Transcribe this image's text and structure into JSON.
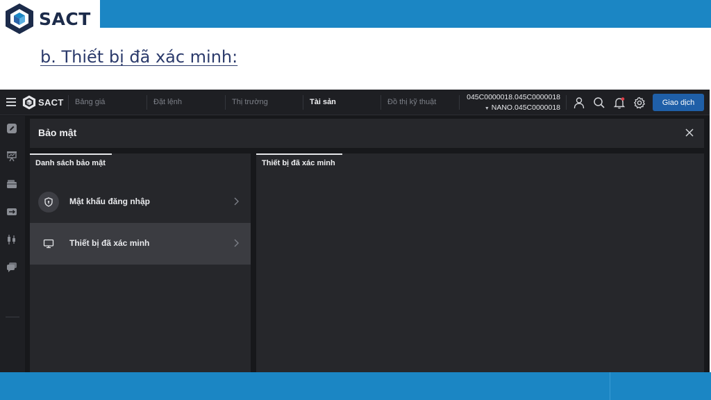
{
  "slide": {
    "logo_text": "SACT",
    "heading": "b. Thiết bị đã xác minh:"
  },
  "app": {
    "logo_text": "SACT",
    "nav": [
      {
        "label": "Bảng giá"
      },
      {
        "label": "Đặt lệnh"
      },
      {
        "label": "Thị trường"
      },
      {
        "label": "Tài sản",
        "active": true
      },
      {
        "label": "Đồ thị kỹ thuật"
      }
    ],
    "account": {
      "line1": "045C0000018.045C0000018",
      "line2": "NANO.045C0000018"
    },
    "trade_button": "Giao dịch",
    "panel": {
      "title": "Bảo mật",
      "left_tab": "Danh sách bảo mật",
      "right_tab": "Thiết bị đã xác minh",
      "items": [
        {
          "label": "Mật khẩu đăng nhập",
          "icon": "shield-icon"
        },
        {
          "label": "Thiết bị đã xác minh",
          "icon": "monitor-icon",
          "selected": true
        }
      ]
    },
    "colors": {
      "accent": "#1b86c4",
      "trade_button": "#1f5fa8",
      "background": "#17181b",
      "panel": "#26272b"
    }
  }
}
